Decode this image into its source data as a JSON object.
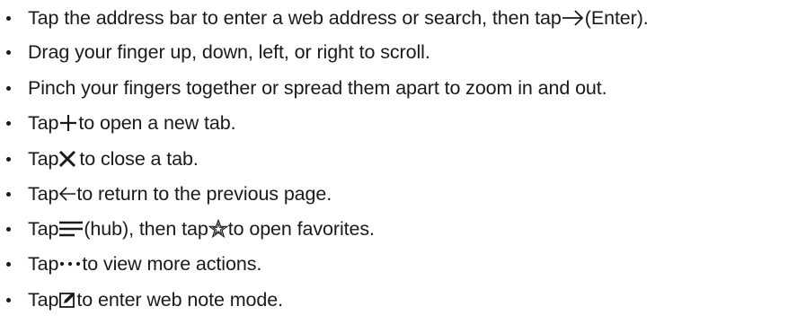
{
  "instructions": [
    {
      "before": "Tap the address bar to enter a web address or search, then tap ",
      "icon": "arrow-right-icon",
      "after": " (Enter)."
    },
    {
      "before": "Drag your finger up, down, left, or right to scroll.",
      "icon": "",
      "after": ""
    },
    {
      "before": "Pinch your fingers together or spread them apart to zoom in and out.",
      "icon": "",
      "after": ""
    },
    {
      "before": "Tap ",
      "icon": "plus-icon",
      "after": " to open a new tab."
    },
    {
      "before": "Tap ",
      "icon": "close-icon",
      "after": "to close a tab."
    },
    {
      "before": "Tap ",
      "icon": "arrow-left-icon",
      "after": " to return to the previous page."
    },
    {
      "before": "Tap ",
      "icon": "hub-icon",
      "mid": " (hub), then tap ",
      "icon2": "star-outline-icon",
      "after": " to open favorites."
    },
    {
      "before": "Tap ",
      "icon": "more-icon",
      "after": " to view more actions."
    },
    {
      "before": "Tap ",
      "icon": "web-note-icon",
      "after": " to enter web note mode."
    }
  ]
}
